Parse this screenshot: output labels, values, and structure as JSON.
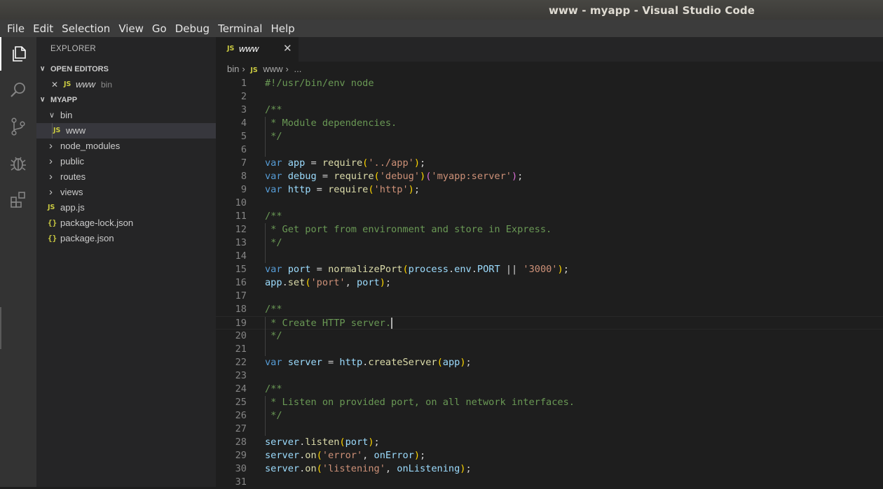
{
  "window": {
    "title": "www - myapp - Visual Studio Code"
  },
  "menu": [
    "File",
    "Edit",
    "Selection",
    "View",
    "Go",
    "Debug",
    "Terminal",
    "Help"
  ],
  "activity_bar": [
    "files-icon",
    "search-icon",
    "source-control-icon",
    "debug-icon",
    "extensions-icon"
  ],
  "sidebar": {
    "title": "EXPLORER",
    "open_editors": {
      "header": "OPEN EDITORS",
      "items": [
        {
          "close": "✕",
          "icon": "JS",
          "name": "www",
          "path": "bin"
        }
      ]
    },
    "project": {
      "header": "MYAPP",
      "items": [
        {
          "type": "folder",
          "name": "bin",
          "expanded": true,
          "depth": 1
        },
        {
          "type": "js",
          "icon": "JS",
          "name": "www",
          "depth": 2,
          "selected": true
        },
        {
          "type": "folder",
          "name": "node_modules",
          "depth": 1
        },
        {
          "type": "folder",
          "name": "public",
          "depth": 1
        },
        {
          "type": "folder",
          "name": "routes",
          "depth": 1
        },
        {
          "type": "folder",
          "name": "views",
          "depth": 1
        },
        {
          "type": "js",
          "icon": "JS",
          "name": "app.js",
          "depth": 1
        },
        {
          "type": "json",
          "icon": "{}",
          "name": "package-lock.json",
          "depth": 1
        },
        {
          "type": "json",
          "icon": "{}",
          "name": "package.json",
          "depth": 1
        }
      ]
    }
  },
  "editor": {
    "tab": {
      "icon": "JS",
      "label": "www",
      "close": "✕"
    },
    "breadcrumbs": {
      "folder": "bin",
      "icon": "JS",
      "file": "www",
      "more": "..."
    },
    "current_line": 19,
    "lines": [
      [
        [
          "c",
          "#!/usr/bin/env node"
        ]
      ],
      [],
      [
        [
          "c",
          "/**"
        ]
      ],
      [
        [
          "c",
          " * Module dependencies."
        ]
      ],
      [
        [
          "c",
          " */"
        ]
      ],
      [],
      [
        [
          "k",
          "var "
        ],
        [
          "v",
          "app"
        ],
        [
          "p",
          " = "
        ],
        [
          "f",
          "require"
        ],
        [
          "y",
          "("
        ],
        [
          "s",
          "'../app'"
        ],
        [
          "y",
          ")"
        ],
        [
          "p",
          ";"
        ]
      ],
      [
        [
          "k",
          "var "
        ],
        [
          "v",
          "debug"
        ],
        [
          "p",
          " = "
        ],
        [
          "f",
          "require"
        ],
        [
          "y",
          "("
        ],
        [
          "s",
          "'debug'"
        ],
        [
          "y",
          ")"
        ],
        [
          "m",
          "("
        ],
        [
          "s",
          "'myapp:server'"
        ],
        [
          "m",
          ")"
        ],
        [
          "p",
          ";"
        ]
      ],
      [
        [
          "k",
          "var "
        ],
        [
          "v",
          "http"
        ],
        [
          "p",
          " = "
        ],
        [
          "f",
          "require"
        ],
        [
          "y",
          "("
        ],
        [
          "s",
          "'http'"
        ],
        [
          "y",
          ")"
        ],
        [
          "p",
          ";"
        ]
      ],
      [],
      [
        [
          "c",
          "/**"
        ]
      ],
      [
        [
          "c",
          " * Get port from environment and store in Express."
        ]
      ],
      [
        [
          "c",
          " */"
        ]
      ],
      [],
      [
        [
          "k",
          "var "
        ],
        [
          "v",
          "port"
        ],
        [
          "p",
          " = "
        ],
        [
          "f",
          "normalizePort"
        ],
        [
          "y",
          "("
        ],
        [
          "v",
          "process"
        ],
        [
          "p",
          "."
        ],
        [
          "v",
          "env"
        ],
        [
          "p",
          "."
        ],
        [
          "v",
          "PORT"
        ],
        [
          "p",
          " || "
        ],
        [
          "s",
          "'3000'"
        ],
        [
          "y",
          ")"
        ],
        [
          "p",
          ";"
        ]
      ],
      [
        [
          "v",
          "app"
        ],
        [
          "p",
          "."
        ],
        [
          "f",
          "set"
        ],
        [
          "y",
          "("
        ],
        [
          "s",
          "'port'"
        ],
        [
          "p",
          ", "
        ],
        [
          "v",
          "port"
        ],
        [
          "y",
          ")"
        ],
        [
          "p",
          ";"
        ]
      ],
      [],
      [
        [
          "c",
          "/**"
        ]
      ],
      [
        [
          "c",
          " * Create HTTP server."
        ]
      ],
      [
        [
          "c",
          " */"
        ]
      ],
      [],
      [
        [
          "k",
          "var "
        ],
        [
          "v",
          "server"
        ],
        [
          "p",
          " = "
        ],
        [
          "v",
          "http"
        ],
        [
          "p",
          "."
        ],
        [
          "f",
          "createServer"
        ],
        [
          "y",
          "("
        ],
        [
          "v",
          "app"
        ],
        [
          "y",
          ")"
        ],
        [
          "p",
          ";"
        ]
      ],
      [],
      [
        [
          "c",
          "/**"
        ]
      ],
      [
        [
          "c",
          " * Listen on provided port, on all network interfaces."
        ]
      ],
      [
        [
          "c",
          " */"
        ]
      ],
      [],
      [
        [
          "v",
          "server"
        ],
        [
          "p",
          "."
        ],
        [
          "f",
          "listen"
        ],
        [
          "y",
          "("
        ],
        [
          "v",
          "port"
        ],
        [
          "y",
          ")"
        ],
        [
          "p",
          ";"
        ]
      ],
      [
        [
          "v",
          "server"
        ],
        [
          "p",
          "."
        ],
        [
          "f",
          "on"
        ],
        [
          "y",
          "("
        ],
        [
          "s",
          "'error'"
        ],
        [
          "p",
          ", "
        ],
        [
          "v",
          "onError"
        ],
        [
          "y",
          ")"
        ],
        [
          "p",
          ";"
        ]
      ],
      [
        [
          "v",
          "server"
        ],
        [
          "p",
          "."
        ],
        [
          "f",
          "on"
        ],
        [
          "y",
          "("
        ],
        [
          "s",
          "'listening'"
        ],
        [
          "p",
          ", "
        ],
        [
          "v",
          "onListening"
        ],
        [
          "y",
          ")"
        ],
        [
          "p",
          ";"
        ]
      ],
      []
    ]
  }
}
